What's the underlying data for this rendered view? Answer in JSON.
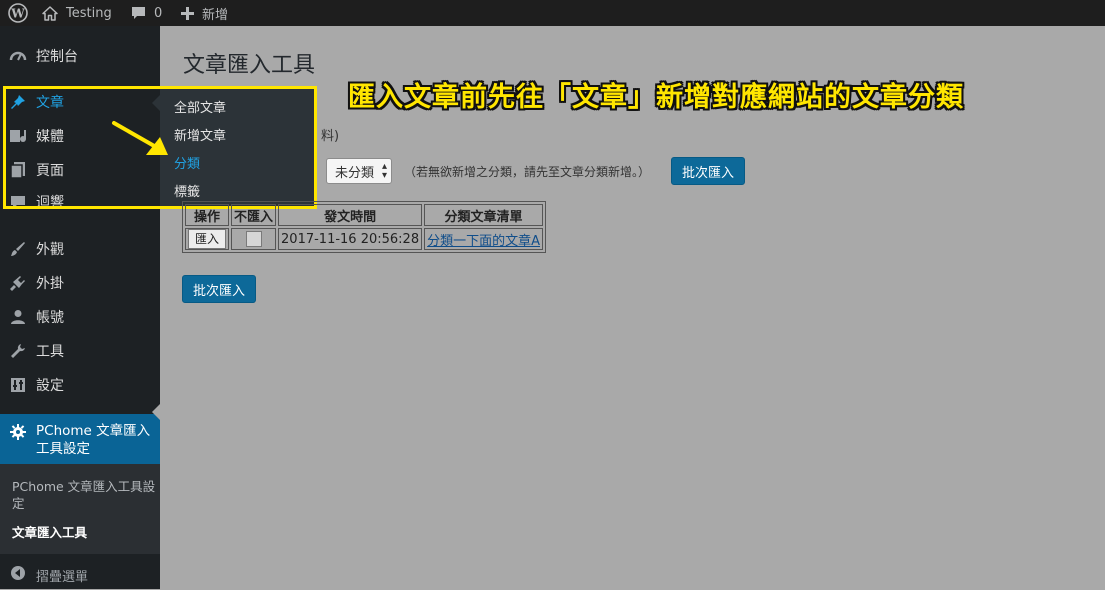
{
  "admin_bar": {
    "site_name": "Testing",
    "comments_count": "0",
    "new_label": "新增"
  },
  "sidebar": {
    "items": [
      {
        "label": "控制台",
        "icon": "dashboard-icon"
      },
      {
        "label": "文章",
        "icon": "pin-icon"
      },
      {
        "label": "媒體",
        "icon": "media-icon"
      },
      {
        "label": "頁面",
        "icon": "page-icon"
      },
      {
        "label": "迴響",
        "icon": "comment-icon"
      },
      {
        "label": "外觀",
        "icon": "brush-icon"
      },
      {
        "label": "外掛",
        "icon": "plugin-icon"
      },
      {
        "label": "帳號",
        "icon": "user-icon"
      },
      {
        "label": "工具",
        "icon": "wrench-icon"
      },
      {
        "label": "設定",
        "icon": "settings-icon"
      }
    ],
    "plugin_menu": {
      "label": "PChome 文章匯入工具設定",
      "icon": "gear-icon"
    },
    "plugin_submenu": [
      {
        "label": "PChome 文章匯入工具設定"
      },
      {
        "label": "文章匯入工具"
      }
    ],
    "collapse_label": "摺疊選單"
  },
  "flyout": {
    "items": [
      {
        "label": "全部文章"
      },
      {
        "label": "新增文章"
      },
      {
        "label": "分類"
      },
      {
        "label": "標籤"
      }
    ]
  },
  "main": {
    "title": "文章匯入工具",
    "partial_text": "料)",
    "category_select": {
      "value": "未分類"
    },
    "hint": "（若無欲新增之分類，請先至文章分類新增。）",
    "batch_button": "批次匯入",
    "table": {
      "headers": [
        "操作",
        "不匯入",
        "發文時間",
        "分類文章清單"
      ],
      "rows": [
        {
          "action": "匯入",
          "time": "2017-11-16 20:56:28",
          "link": "分類一下面的文章A"
        }
      ]
    },
    "batch_button_bottom": "批次匯入"
  },
  "annotation": {
    "text": "匯入文章前先往「文章」新增對應網站的文章分類",
    "color": "#ffe600"
  },
  "colors": {
    "accent": "#0a6496",
    "sidebar": "#1d2124",
    "highlight": "#ffe600"
  }
}
